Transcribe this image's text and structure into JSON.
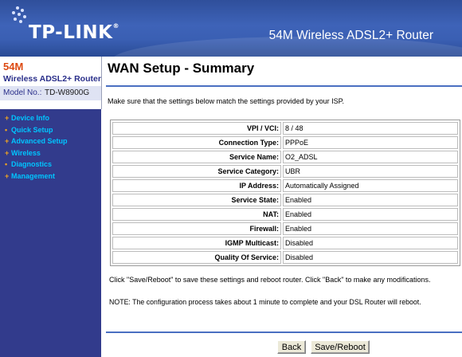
{
  "header": {
    "logo": "TP-LINK",
    "logo_mark": "®",
    "product_title": "54M Wireless ADSL2+ Router"
  },
  "brand": {
    "speed": "54M",
    "product": "Wireless ADSL2+ Router",
    "model_label": "Model No.:",
    "model_value": "TD-W8900G"
  },
  "sidebar": {
    "items": [
      {
        "marker": "+",
        "label": "Device Info"
      },
      {
        "marker": "•",
        "label": "Quick Setup"
      },
      {
        "marker": "+",
        "label": "Advanced Setup"
      },
      {
        "marker": "+",
        "label": "Wireless"
      },
      {
        "marker": "•",
        "label": "Diagnostics"
      },
      {
        "marker": "+",
        "label": "Management"
      }
    ]
  },
  "main": {
    "title": "WAN Setup - Summary",
    "intro": "Make sure that the settings below match the settings provided by your ISP.",
    "summary": [
      {
        "label": "VPI / VCI:",
        "value": "8 / 48"
      },
      {
        "label": "Connection Type:",
        "value": "PPPoE"
      },
      {
        "label": "Service Name:",
        "value": "O2_ADSL"
      },
      {
        "label": "Service Category:",
        "value": "UBR"
      },
      {
        "label": "IP Address:",
        "value": "Automatically Assigned"
      },
      {
        "label": "Service State:",
        "value": "Enabled"
      },
      {
        "label": "NAT:",
        "value": "Enabled"
      },
      {
        "label": "Firewall:",
        "value": "Enabled"
      },
      {
        "label": "IGMP Multicast:",
        "value": "Disabled"
      },
      {
        "label": "Quality Of Service:",
        "value": "Disabled"
      }
    ],
    "note_save": "Click \"Save/Reboot\" to save these settings and reboot router. Click \"Back\" to make any modifications.",
    "note_config": "NOTE: The configuration process takes about 1 minute to complete and your DSL Router will reboot."
  },
  "buttons": {
    "back": "Back",
    "save_reboot": "Save/Reboot"
  },
  "colors": {
    "header_blue": "#3a5fb3",
    "sidebar_navy": "#323b8c",
    "nav_link": "#00c5ff",
    "nav_marker": "#f0a520",
    "brand_orange": "#dd4a12",
    "rule_blue": "#4a6fc1"
  }
}
